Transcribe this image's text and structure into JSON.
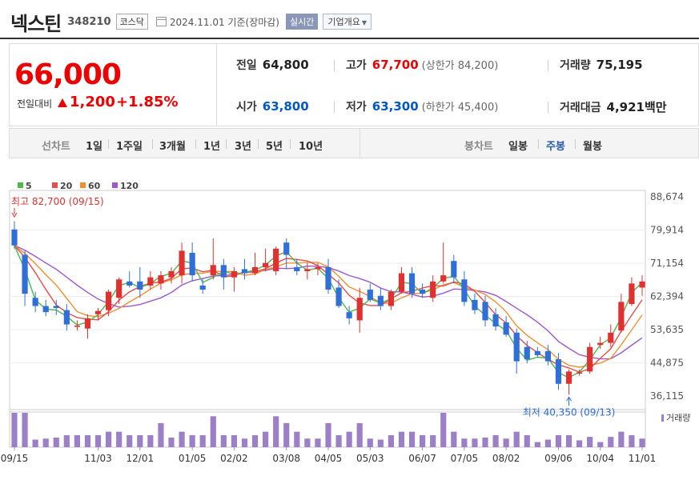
{
  "header": {
    "stock_name": "넥스틴",
    "stock_code": "348210",
    "market": "코스닥",
    "date_text": "2024.11.01  기준(장마감)",
    "realtime_label": "실시간",
    "company_label": "기업개요"
  },
  "quote": {
    "price": "66,000",
    "prev_label": "전일대비",
    "change": "1,200",
    "change_pct": "+1.85%",
    "prev_close_label": "전일",
    "prev_close": "64,800",
    "high_label": "고가",
    "high": "67,700",
    "upper_limit": "(상한가 84,200)",
    "volume_label": "거래량",
    "volume": "75,195",
    "open_label": "시가",
    "open": "63,800",
    "low_label": "저가",
    "low": "63,300",
    "lower_limit": "(하한가 45,400)",
    "amount_label": "거래대금",
    "amount": "4,921백만"
  },
  "tabs": {
    "line_label": "선차트",
    "line_periods": [
      "1일",
      "1주일",
      "3개월",
      "1년",
      "3년",
      "5년",
      "10년"
    ],
    "candle_label": "봉차트",
    "candle_periods": [
      "일봉",
      "주봉",
      "월봉"
    ],
    "active_candle": "주봉"
  },
  "colors": {
    "up": "#e03030",
    "down": "#2f6fd6",
    "ma5": "#4db84d",
    "ma20": "#e84c4c",
    "ma60": "#f09030",
    "ma120": "#9b59d0",
    "volume": "#9b80c8"
  },
  "chart_data": {
    "type": "candlestick",
    "legend": [
      "5",
      "20",
      "60",
      "120"
    ],
    "y_ticks": [
      "88,674",
      "79,914",
      "71,154",
      "62,394",
      "53,635",
      "44,875",
      "36,115"
    ],
    "ylim": [
      36115,
      88674
    ],
    "x_ticks": [
      {
        "i": 0,
        "label": "09/15"
      },
      {
        "i": 8,
        "label": "11/03"
      },
      {
        "i": 12,
        "label": "12/01"
      },
      {
        "i": 17,
        "label": "01/05"
      },
      {
        "i": 21,
        "label": "02/02"
      },
      {
        "i": 26,
        "label": "03/08"
      },
      {
        "i": 30,
        "label": "04/05"
      },
      {
        "i": 34,
        "label": "05/03"
      },
      {
        "i": 39,
        "label": "06/07"
      },
      {
        "i": 43,
        "label": "07/05"
      },
      {
        "i": 47,
        "label": "08/02"
      },
      {
        "i": 52,
        "label": "09/06"
      },
      {
        "i": 56,
        "label": "10/04"
      },
      {
        "i": 60,
        "label": "11/01"
      }
    ],
    "max_annotation": "최고 82,700 (09/15)",
    "min_annotation": "최저 40,350 (09/13)",
    "volume_label": "거래량",
    "candles": [
      {
        "o": 80700,
        "h": 82700,
        "l": 76000,
        "c": 76800,
        "v": 100
      },
      {
        "o": 74500,
        "h": 75500,
        "l": 62000,
        "c": 65000,
        "v": 100
      },
      {
        "o": 64000,
        "h": 65500,
        "l": 60500,
        "c": 62000,
        "v": 22
      },
      {
        "o": 62000,
        "h": 63500,
        "l": 59500,
        "c": 60500,
        "v": 25
      },
      {
        "o": 62000,
        "h": 63500,
        "l": 59800,
        "c": 61500,
        "v": 28
      },
      {
        "o": 61000,
        "h": 62500,
        "l": 56000,
        "c": 57500,
        "v": 35
      },
      {
        "o": 57000,
        "h": 58500,
        "l": 56000,
        "c": 57200,
        "v": 35
      },
      {
        "o": 56500,
        "h": 60000,
        "l": 54000,
        "c": 59000,
        "v": 35
      },
      {
        "o": 60000,
        "h": 61500,
        "l": 58500,
        "c": 60800,
        "v": 35
      },
      {
        "o": 61000,
        "h": 66000,
        "l": 59500,
        "c": 65500,
        "v": 45
      },
      {
        "o": 64000,
        "h": 69000,
        "l": 62500,
        "c": 68500,
        "v": 45
      },
      {
        "o": 68000,
        "h": 70500,
        "l": 66500,
        "c": 67000,
        "v": 35
      },
      {
        "o": 68000,
        "h": 71500,
        "l": 64000,
        "c": 66000,
        "v": 35
      },
      {
        "o": 67000,
        "h": 70500,
        "l": 66000,
        "c": 69000,
        "v": 35
      },
      {
        "o": 67500,
        "h": 70500,
        "l": 66000,
        "c": 69500,
        "v": 70
      },
      {
        "o": 69000,
        "h": 71500,
        "l": 67500,
        "c": 70500,
        "v": 28
      },
      {
        "o": 69500,
        "h": 77500,
        "l": 67500,
        "c": 75500,
        "v": 45
      },
      {
        "o": 75000,
        "h": 77500,
        "l": 68000,
        "c": 69500,
        "v": 35
      },
      {
        "o": 67000,
        "h": 68500,
        "l": 65000,
        "c": 66000,
        "v": 35
      },
      {
        "o": 69500,
        "h": 78500,
        "l": 68500,
        "c": 72000,
        "v": 90
      },
      {
        "o": 72000,
        "h": 73500,
        "l": 66000,
        "c": 69000,
        "v": 35
      },
      {
        "o": 69000,
        "h": 71500,
        "l": 65500,
        "c": 70500,
        "v": 35
      },
      {
        "o": 71000,
        "h": 73500,
        "l": 68500,
        "c": 70000,
        "v": 25
      },
      {
        "o": 70000,
        "h": 75000,
        "l": 69500,
        "c": 71500,
        "v": 35
      },
      {
        "o": 71500,
        "h": 76000,
        "l": 70500,
        "c": 72500,
        "v": 45
      },
      {
        "o": 70500,
        "h": 76500,
        "l": 69500,
        "c": 76000,
        "v": 90
      },
      {
        "o": 77500,
        "h": 78500,
        "l": 71000,
        "c": 74500,
        "v": 70
      },
      {
        "o": 71500,
        "h": 73500,
        "l": 69500,
        "c": 70500,
        "v": 45
      },
      {
        "o": 70500,
        "h": 72500,
        "l": 68500,
        "c": 71000,
        "v": 25
      },
      {
        "o": 71000,
        "h": 72500,
        "l": 69500,
        "c": 71500,
        "v": 25
      },
      {
        "o": 71500,
        "h": 73500,
        "l": 65000,
        "c": 66000,
        "v": 70
      },
      {
        "o": 66500,
        "h": 68500,
        "l": 61500,
        "c": 62000,
        "v": 35
      },
      {
        "o": 60500,
        "h": 62000,
        "l": 57500,
        "c": 59000,
        "v": 45
      },
      {
        "o": 58500,
        "h": 66500,
        "l": 55500,
        "c": 64000,
        "v": 70
      },
      {
        "o": 66000,
        "h": 67500,
        "l": 63000,
        "c": 63500,
        "v": 25
      },
      {
        "o": 64500,
        "h": 66500,
        "l": 61000,
        "c": 62000,
        "v": 22
      },
      {
        "o": 62000,
        "h": 66000,
        "l": 61000,
        "c": 65500,
        "v": 35
      },
      {
        "o": 65500,
        "h": 71500,
        "l": 65000,
        "c": 70000,
        "v": 45
      },
      {
        "o": 70000,
        "h": 71500,
        "l": 64000,
        "c": 65000,
        "v": 45
      },
      {
        "o": 66000,
        "h": 67500,
        "l": 64000,
        "c": 65000,
        "v": 35
      },
      {
        "o": 64000,
        "h": 69500,
        "l": 63000,
        "c": 68000,
        "v": 35
      },
      {
        "o": 68000,
        "h": 77500,
        "l": 67500,
        "c": 69500,
        "v": 100
      },
      {
        "o": 73000,
        "h": 74500,
        "l": 67500,
        "c": 69000,
        "v": 45
      },
      {
        "o": 68500,
        "h": 70500,
        "l": 62000,
        "c": 63000,
        "v": 25
      },
      {
        "o": 63500,
        "h": 65000,
        "l": 60000,
        "c": 61000,
        "v": 25
      },
      {
        "o": 63000,
        "h": 64500,
        "l": 57000,
        "c": 58500,
        "v": 28
      },
      {
        "o": 60000,
        "h": 61500,
        "l": 56000,
        "c": 57000,
        "v": 35
      },
      {
        "o": 58000,
        "h": 59500,
        "l": 54500,
        "c": 55000,
        "v": 25
      },
      {
        "o": 55500,
        "h": 56500,
        "l": 45500,
        "c": 48500,
        "v": 45
      },
      {
        "o": 52000,
        "h": 53500,
        "l": 48000,
        "c": 49000,
        "v": 35
      },
      {
        "o": 51000,
        "h": 52000,
        "l": 49500,
        "c": 50000,
        "v": 15
      },
      {
        "o": 51000,
        "h": 52500,
        "l": 47500,
        "c": 48500,
        "v": 22
      },
      {
        "o": 49000,
        "h": 50500,
        "l": 41500,
        "c": 43000,
        "v": 35
      },
      {
        "o": 43000,
        "h": 46500,
        "l": 40350,
        "c": 46000,
        "v": 35
      },
      {
        "o": 45500,
        "h": 46500,
        "l": 45000,
        "c": 45800,
        "v": 20
      },
      {
        "o": 46000,
        "h": 53000,
        "l": 45500,
        "c": 52000,
        "v": 30
      },
      {
        "o": 52500,
        "h": 54500,
        "l": 51500,
        "c": 53000,
        "v": 15
      },
      {
        "o": 53000,
        "h": 57500,
        "l": 52000,
        "c": 55500,
        "v": 30
      },
      {
        "o": 56000,
        "h": 65000,
        "l": 55500,
        "c": 63000,
        "v": 45
      },
      {
        "o": 62500,
        "h": 69000,
        "l": 62000,
        "c": 67500,
        "v": 35
      },
      {
        "o": 66500,
        "h": 69500,
        "l": 64500,
        "c": 68000,
        "v": 25
      }
    ]
  }
}
